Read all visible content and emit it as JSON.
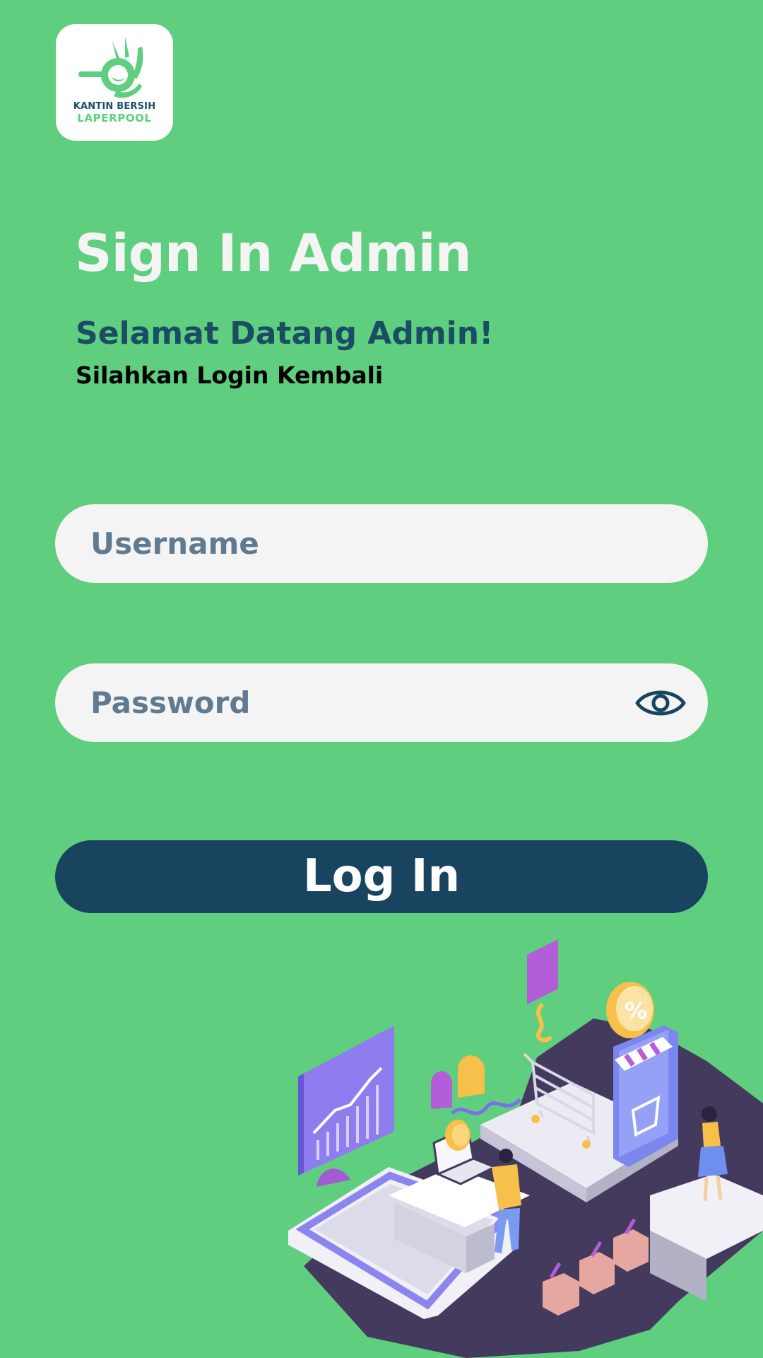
{
  "logo": {
    "line1": "KANTIN BERSIH",
    "line2": "LAPERPOOL"
  },
  "header": {
    "title": "Sign In Admin",
    "welcome": "Selamat Datang Admin!",
    "subtitle": "Silahkan Login Kembali"
  },
  "form": {
    "username_placeholder": "Username",
    "password_placeholder": "Password",
    "login_label": "Log In"
  },
  "icons": {
    "password_toggle": "eye-icon"
  },
  "colors": {
    "background": "#5fce7e",
    "primary": "#184460",
    "field": "#f4f4f4",
    "placeholder": "#607b91"
  }
}
